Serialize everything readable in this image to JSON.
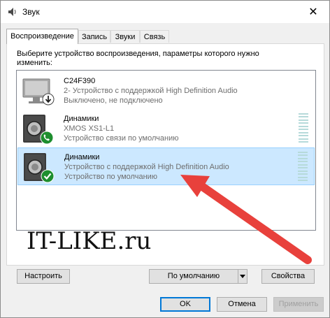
{
  "window": {
    "title": "Звук",
    "close_glyph": "✕"
  },
  "tabs": [
    {
      "label": "Воспроизведение",
      "active": true
    },
    {
      "label": "Запись",
      "active": false
    },
    {
      "label": "Звуки",
      "active": false
    },
    {
      "label": "Связь",
      "active": false
    }
  ],
  "instruction": "Выберите устройство воспроизведения, параметры которого нужно изменить:",
  "devices": [
    {
      "name": "C24F390",
      "line1": "2- Устройство с поддержкой High Definition Audio",
      "line2": "Выключено, не подключено",
      "icon": "monitor-icon",
      "badge": "down-arrow-badge-icon",
      "selected": false
    },
    {
      "name": "Динамики",
      "line1": "XMOS XS1-L1",
      "line2": "Устройство связи по умолчанию",
      "icon": "speaker-icon",
      "badge": "phone-badge-icon",
      "selected": false
    },
    {
      "name": "Динамики",
      "line1": "Устройство с поддержкой High Definition Audio",
      "line2": "Устройство по умолчанию",
      "icon": "speaker-icon",
      "badge": "checkmark-badge-icon",
      "selected": true
    }
  ],
  "watermark": "IT-LIKE.ru",
  "buttons": {
    "configure": "Настроить",
    "set_default": "По умолчанию",
    "properties": "Свойства",
    "ok": "OK",
    "cancel": "Отмена",
    "apply": "Применить"
  },
  "colors": {
    "selection": "#cce8ff",
    "arrow": "#e8413c",
    "accent": "#0078d7",
    "badge_green": "#1e8e2e"
  }
}
